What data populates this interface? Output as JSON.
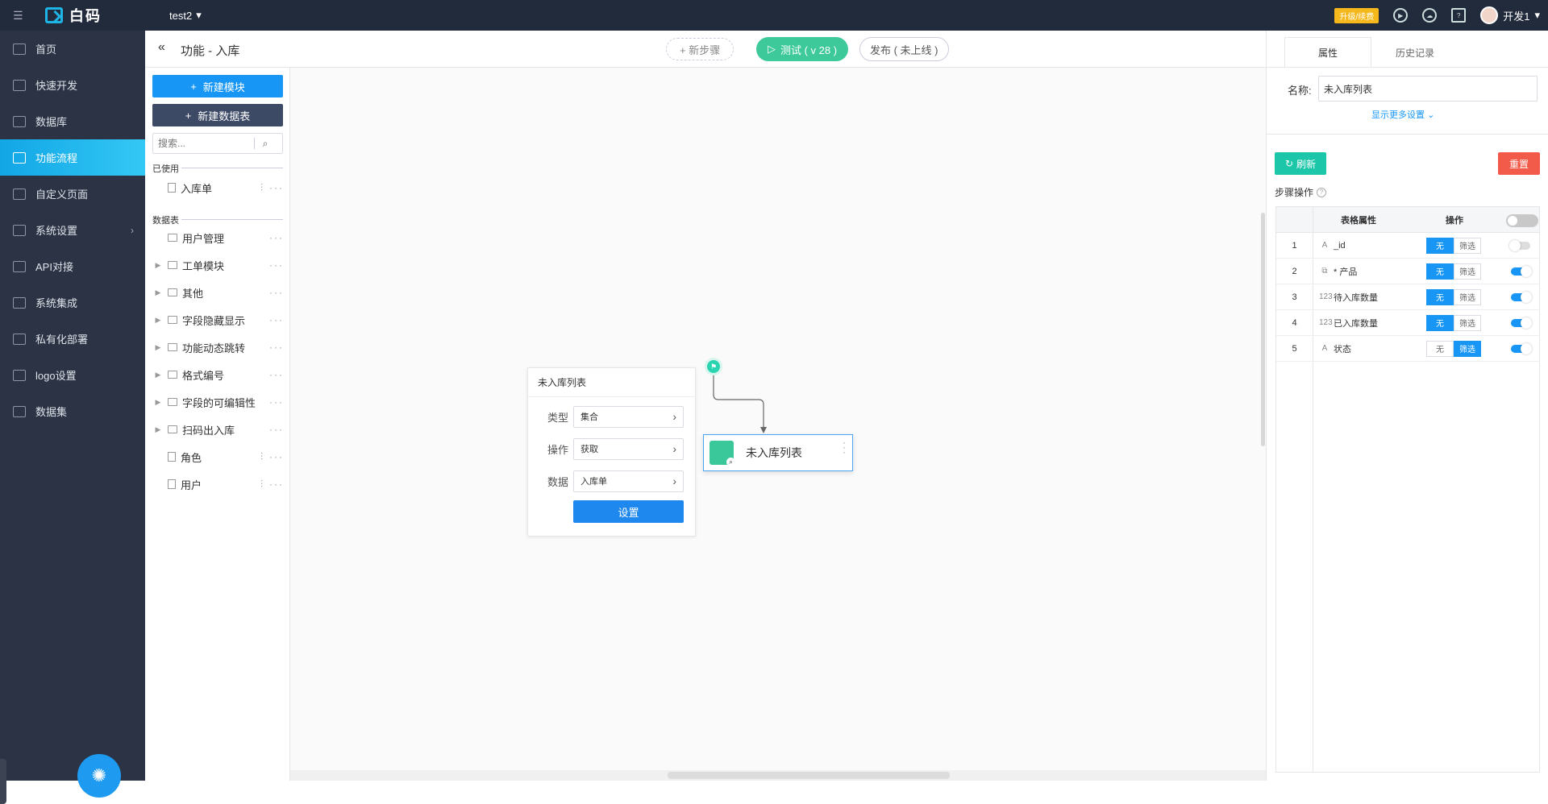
{
  "app": {
    "logo_text": "白码",
    "project": "test2",
    "upgrade_label": "升级/续费",
    "user_name": "开发1"
  },
  "sidebar": {
    "items": [
      {
        "label": "首页",
        "icon": "home-icon"
      },
      {
        "label": "快速开发",
        "icon": "cube-icon"
      },
      {
        "label": "数据库",
        "icon": "database-icon"
      },
      {
        "label": "功能流程",
        "icon": "flow-icon",
        "active": true
      },
      {
        "label": "自定义页面",
        "icon": "page-icon"
      },
      {
        "label": "系统设置",
        "icon": "settings-icon",
        "has_children": true
      },
      {
        "label": "API对接",
        "icon": "api-icon"
      },
      {
        "label": "系统集成",
        "icon": "layers-icon"
      },
      {
        "label": "私有化部署",
        "icon": "lock-icon"
      },
      {
        "label": "logo设置",
        "icon": "logo-icon"
      },
      {
        "label": "数据集",
        "icon": "dataset-icon"
      }
    ]
  },
  "header": {
    "title": "功能 - 入库",
    "new_step": "+ 新步骤",
    "test_button": "测试 ( v 28 )",
    "publish_button": "发布 ( 未上线 )"
  },
  "modules": {
    "new_module": "新建模块",
    "new_table": "新建数据表",
    "search_placeholder": "搜索...",
    "used_label": "已使用",
    "used_items": [
      {
        "label": "入库单"
      }
    ],
    "tables_label": "数据表",
    "table_items": [
      {
        "label": "用户管理",
        "expandable": false
      },
      {
        "label": "工单模块",
        "expandable": true
      },
      {
        "label": "其他",
        "expandable": true
      },
      {
        "label": "字段隐藏显示",
        "expandable": true
      },
      {
        "label": "功能动态跳转",
        "expandable": true
      },
      {
        "label": "格式编号",
        "expandable": true
      },
      {
        "label": "字段的可编辑性",
        "expandable": true
      },
      {
        "label": "扫码出入库",
        "expandable": true
      },
      {
        "label": "角色",
        "expandable": false
      },
      {
        "label": "用户",
        "expandable": false
      }
    ]
  },
  "canvas": {
    "step_card": {
      "title": "未入库列表",
      "type_label": "类型",
      "type_value": "集合",
      "op_label": "操作",
      "op_value": "获取",
      "data_label": "数据",
      "data_value": "入库单",
      "setting_button": "设置"
    },
    "node_label": "未入库列表"
  },
  "properties": {
    "tabs": [
      "属性",
      "历史记录"
    ],
    "name_label": "名称:",
    "name_value": "未入库列表",
    "more_settings": "显示更多设置",
    "refresh": "刷新",
    "reset": "重置",
    "ops_label": "步骤操作",
    "col_field": "表格属性",
    "col_op": "操作",
    "seg_none": "无",
    "seg_filter": "筛选",
    "rows": [
      {
        "idx": "1",
        "type_icon": "A",
        "field": "_id",
        "mode": "none",
        "enabled": false
      },
      {
        "idx": "2",
        "type_icon": "⧉",
        "field": "* 产品",
        "mode": "none",
        "enabled": true
      },
      {
        "idx": "3",
        "type_icon": "123",
        "field": "待入库数量",
        "mode": "none",
        "enabled": true
      },
      {
        "idx": "4",
        "type_icon": "123",
        "field": "已入库数量",
        "mode": "none",
        "enabled": true
      },
      {
        "idx": "5",
        "type_icon": "A",
        "field": "状态",
        "mode": "filter",
        "enabled": true
      }
    ]
  }
}
